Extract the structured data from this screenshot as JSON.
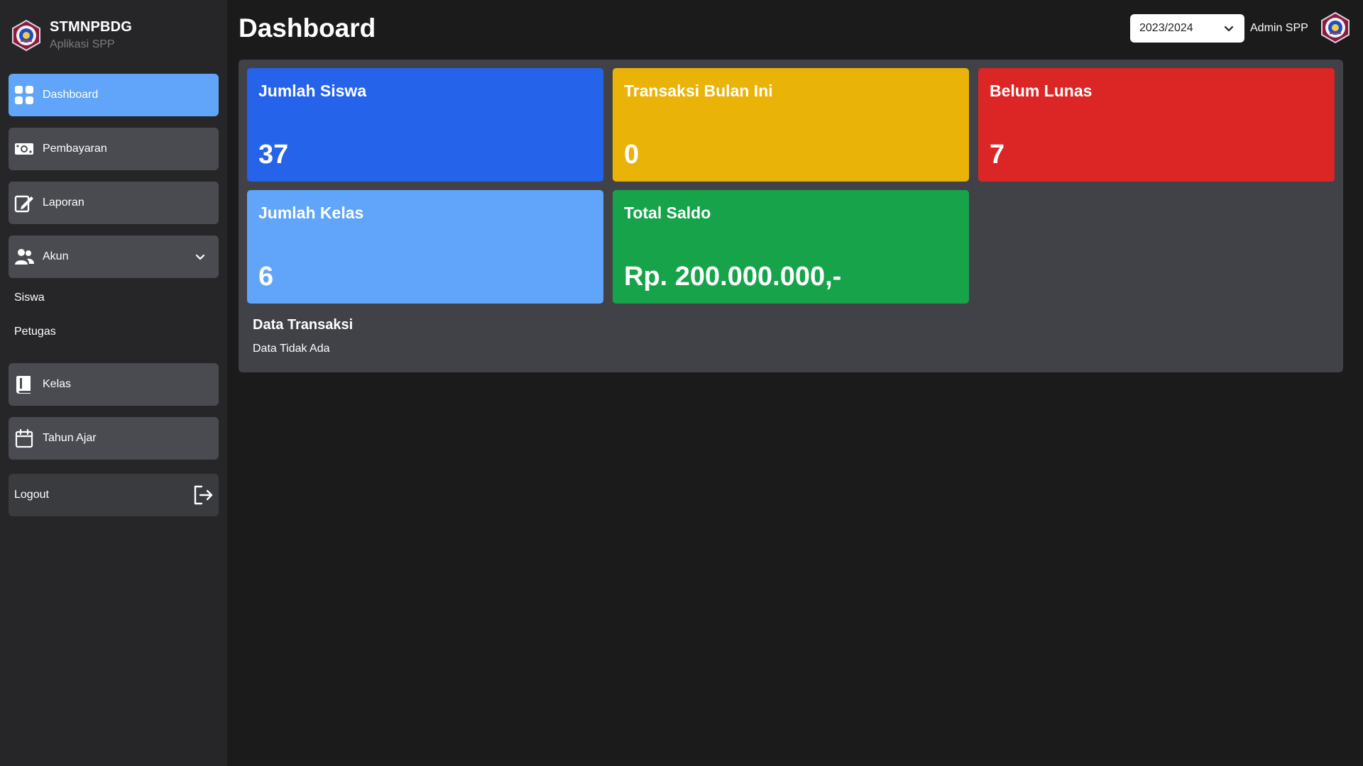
{
  "brand": {
    "title": "STMNPBDG",
    "subtitle": "Aplikasi SPP"
  },
  "sidebar": {
    "items": [
      {
        "label": "Dashboard",
        "icon": "dashboard-grid-icon"
      },
      {
        "label": "Pembayaran",
        "icon": "money-icon"
      },
      {
        "label": "Laporan",
        "icon": "edit-report-icon"
      },
      {
        "label": "Akun",
        "icon": "users-icon"
      },
      {
        "label": "Kelas",
        "icon": "book-icon"
      },
      {
        "label": "Tahun Ajar",
        "icon": "calendar-icon"
      }
    ],
    "akun_sub": [
      "Siswa",
      "Petugas"
    ],
    "logout_label": "Logout"
  },
  "header": {
    "title": "Dashboard",
    "year_selected": "2023/2024",
    "admin_name": "Admin SPP"
  },
  "cards": [
    {
      "title": "Jumlah Siswa",
      "value": "37",
      "color": "#2563eb"
    },
    {
      "title": "Transaksi Bulan Ini",
      "value": "0",
      "color": "#eab308"
    },
    {
      "title": "Belum Lunas",
      "value": "7",
      "color": "#dc2626"
    },
    {
      "title": "Jumlah Kelas",
      "value": "6",
      "color": "#60a5fa"
    },
    {
      "title": "Total Saldo",
      "value": "Rp. 200.000.000,-",
      "color": "#16a34a"
    }
  ],
  "transactions": {
    "title": "Data Transaksi",
    "empty_text": "Data Tidak Ada"
  },
  "colors": {
    "background": "#1b1b1c",
    "sidebar": "#262628",
    "nav_item": "#4a4b51",
    "nav_active": "#60a5fa",
    "panel": "#414248"
  }
}
